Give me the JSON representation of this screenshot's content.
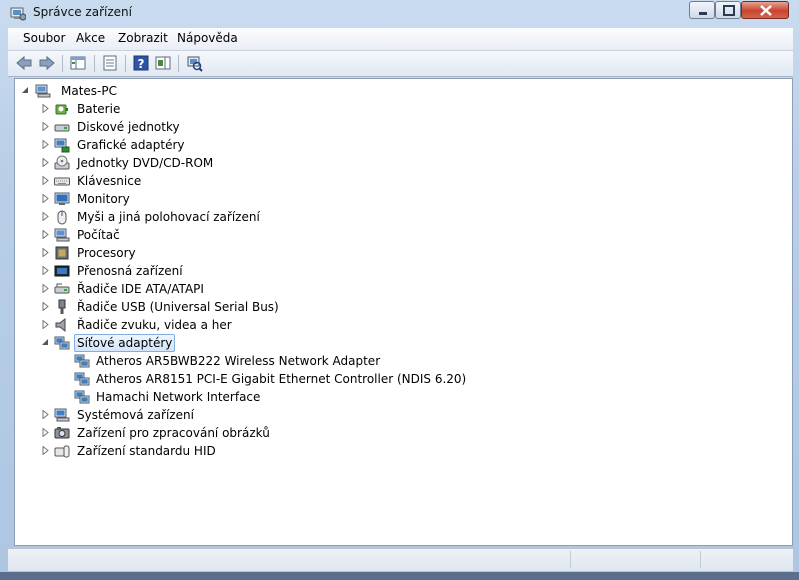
{
  "window": {
    "title": "Správce zařízení",
    "icon": "device-manager-icon"
  },
  "menu": [
    {
      "id": "soubor",
      "label": "Soubor"
    },
    {
      "id": "akce",
      "label": "Akce"
    },
    {
      "id": "zobrazit",
      "label": "Zobrazit"
    },
    {
      "id": "napoveda",
      "label": "Nápověda"
    }
  ],
  "toolbar": [
    {
      "id": "back",
      "icon": "back-arrow-icon"
    },
    {
      "id": "forward",
      "icon": "forward-arrow-icon"
    },
    {
      "id": "show-hide-console-tree",
      "icon": "console-tree-icon"
    },
    {
      "id": "properties",
      "icon": "properties-icon"
    },
    {
      "id": "help",
      "icon": "help-icon"
    },
    {
      "id": "action-pane",
      "icon": "action-pane-icon"
    },
    {
      "id": "scan-hardware",
      "icon": "scan-hardware-icon"
    }
  ],
  "tree": {
    "root": {
      "label": "Mates-PC",
      "icon": "computer-icon",
      "expanded": true
    },
    "items": [
      {
        "label": "Baterie",
        "icon": "battery-icon",
        "expanded": false
      },
      {
        "label": "Diskové jednotky",
        "icon": "disk-drive-icon",
        "expanded": false
      },
      {
        "label": "Grafické adaptéry",
        "icon": "display-adapter-icon",
        "expanded": false
      },
      {
        "label": "Jednotky DVD/CD-ROM",
        "icon": "dvd-drive-icon",
        "expanded": false
      },
      {
        "label": "Klávesnice",
        "icon": "keyboard-icon",
        "expanded": false
      },
      {
        "label": "Monitory",
        "icon": "monitor-icon",
        "expanded": false
      },
      {
        "label": "Myši a jiná polohovací zařízení",
        "icon": "mouse-icon",
        "expanded": false
      },
      {
        "label": "Počítač",
        "icon": "computer-icon",
        "expanded": false
      },
      {
        "label": "Procesory",
        "icon": "processor-icon",
        "expanded": false
      },
      {
        "label": "Přenosná zařízení",
        "icon": "portable-device-icon",
        "expanded": false
      },
      {
        "label": "Řadiče IDE ATA/ATAPI",
        "icon": "ide-controller-icon",
        "expanded": false
      },
      {
        "label": "Řadiče USB (Universal Serial Bus)",
        "icon": "usb-controller-icon",
        "expanded": false
      },
      {
        "label": "Řadiče zvuku, videa a her",
        "icon": "sound-icon",
        "expanded": false
      },
      {
        "label": "Síťové adaptéry",
        "icon": "network-adapter-icon",
        "expanded": true,
        "selected": true,
        "children": [
          {
            "label": "Atheros AR5BWB222 Wireless Network Adapter",
            "icon": "network-adapter-icon"
          },
          {
            "label": "Atheros AR8151 PCI-E Gigabit Ethernet Controller (NDIS 6.20)",
            "icon": "network-adapter-icon"
          },
          {
            "label": "Hamachi Network Interface",
            "icon": "network-adapter-icon"
          }
        ]
      },
      {
        "label": "Systémová zařízení",
        "icon": "system-device-icon",
        "expanded": false
      },
      {
        "label": "Zařízení pro zpracování obrázků",
        "icon": "imaging-device-icon",
        "expanded": false
      },
      {
        "label": "Zařízení standardu HID",
        "icon": "hid-device-icon",
        "expanded": false
      }
    ]
  }
}
